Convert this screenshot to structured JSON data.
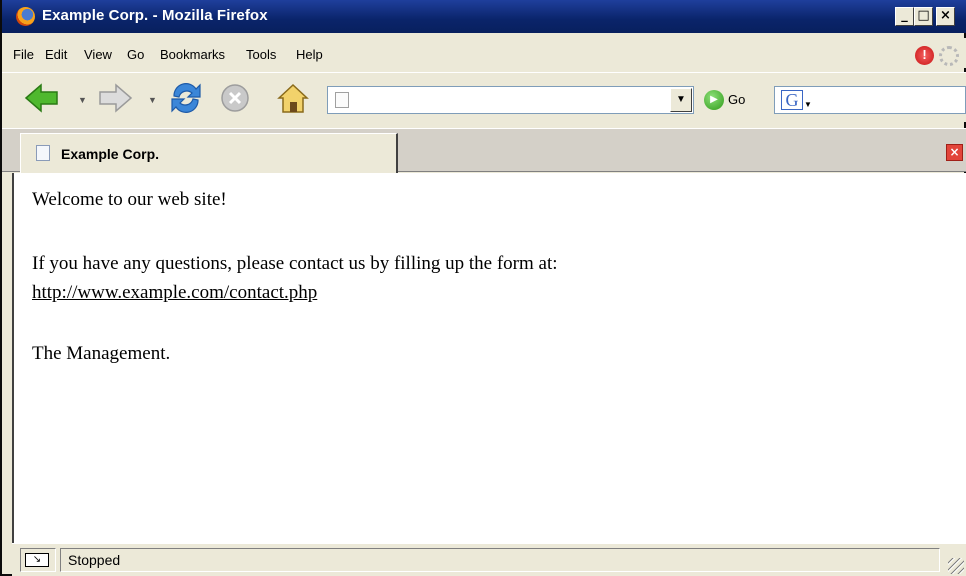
{
  "window": {
    "title": "Example Corp. - Mozilla Firefox"
  },
  "menu": {
    "file": "File",
    "edit": "Edit",
    "view": "View",
    "go": "Go",
    "bookmarks": "Bookmarks",
    "tools": "Tools",
    "help": "Help"
  },
  "navbar": {
    "url": "",
    "go_label": "Go",
    "search_value": ""
  },
  "tabs": [
    {
      "label": "Example Corp.",
      "active": true
    }
  ],
  "page": {
    "welcome": "Welcome to our web site!",
    "questions": "If you have any questions, please contact us by filling up the form at:",
    "link": "http://www.example.com/contact.php",
    "signoff": "The Management."
  },
  "status": {
    "text": "Stopped"
  },
  "icons": {
    "back": "back-arrow-icon",
    "forward": "forward-arrow-icon",
    "reload": "reload-icon",
    "stop": "stop-icon",
    "home": "home-icon",
    "go": "go-icon",
    "search_engine": "google-icon",
    "close_tab": "close-tab-icon"
  },
  "colors": {
    "titlebar": "#0a246a",
    "chrome": "#ece9d8",
    "link": "#1a3fb0",
    "back_arrow": "#4fb82e",
    "forward_arrow": "#c8c8c8"
  }
}
